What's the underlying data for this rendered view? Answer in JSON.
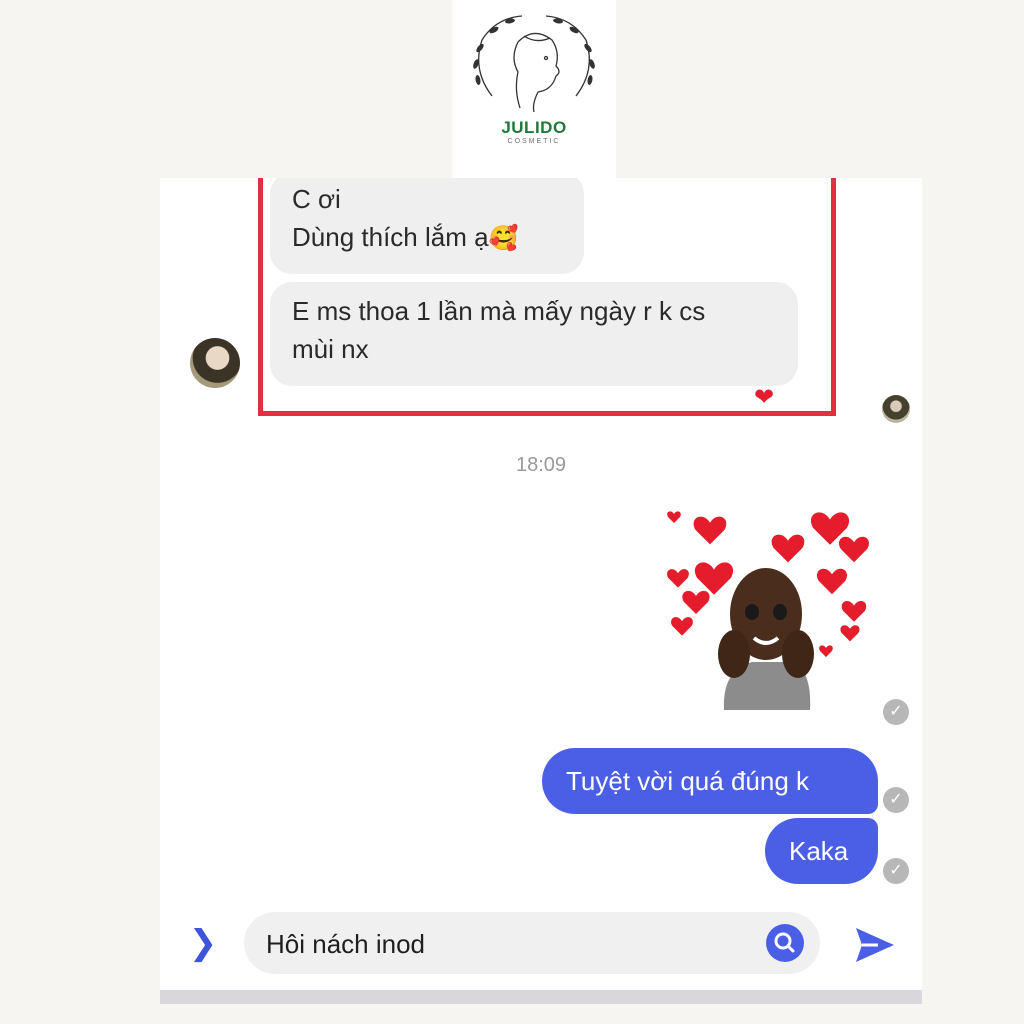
{
  "brand": {
    "name": "JULIDO",
    "tagline": "COSMETIC"
  },
  "conversation": {
    "incoming": [
      {
        "lines": [
          "C ơi",
          "Dùng thích lắm ạ"
        ],
        "emoji": "🥰"
      },
      {
        "lines": [
          "E ms thoa 1 lần mà mấy ngày r k cs",
          "mùi nx"
        ],
        "reaction": "❤"
      }
    ],
    "timestamp": "18:09",
    "outgoing": [
      "Tuyệt vời quá đúng k",
      "Kaka"
    ]
  },
  "composer": {
    "value": "Hôi nách inod"
  },
  "colors": {
    "accent": "#4b5fe6",
    "highlight_border": "#e0303f",
    "incoming_bubble": "#efefef",
    "heart": "#e51c2c"
  },
  "icons": {
    "expand": "chevron-right-icon",
    "search": "search-icon",
    "send": "send-icon",
    "read_receipt": "check-circle-icon"
  }
}
